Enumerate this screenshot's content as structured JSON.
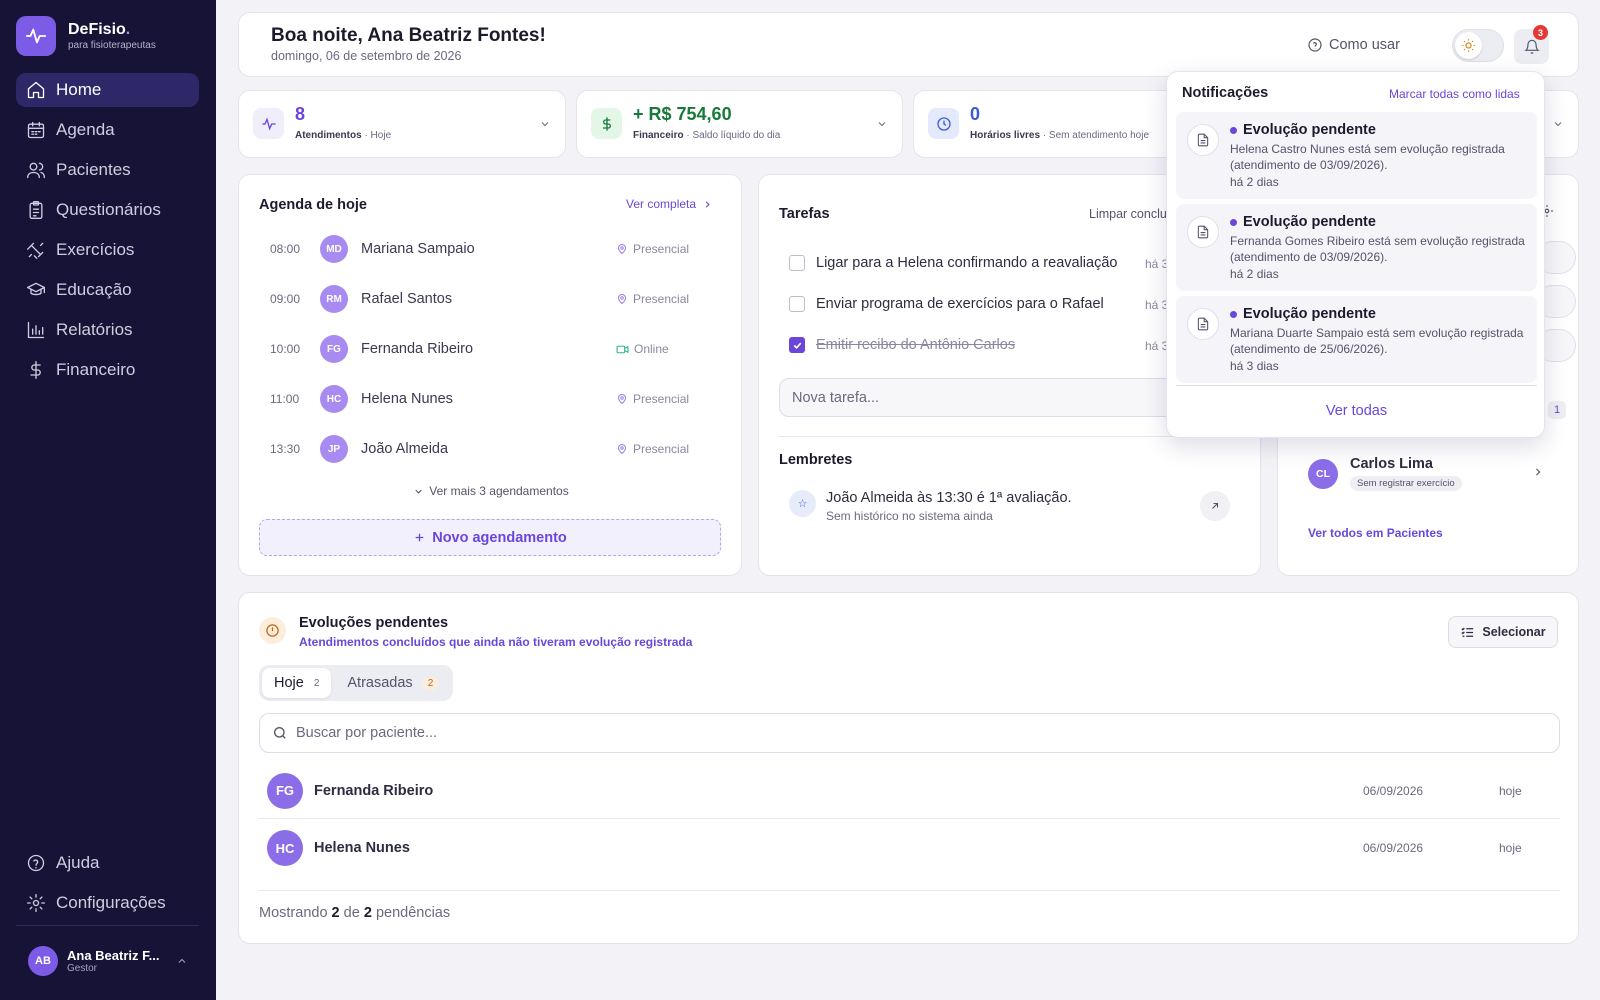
{
  "sidebar": {
    "app_name": "DeFisio",
    "app_tagline": "para fisioterapeutas",
    "nav": [
      {
        "label": "Home",
        "icon": "home-icon",
        "active": true
      },
      {
        "label": "Agenda",
        "icon": "calendar-icon"
      },
      {
        "label": "Pacientes",
        "icon": "users-icon"
      },
      {
        "label": "Questionários",
        "icon": "clipboard-icon"
      },
      {
        "label": "Exercícios",
        "icon": "dumbbell-icon"
      },
      {
        "label": "Educação",
        "icon": "graduation-cap-icon"
      },
      {
        "label": "Relatórios",
        "icon": "bar-chart-icon"
      },
      {
        "label": "Financeiro",
        "icon": "dollar-icon"
      }
    ],
    "bottom": [
      {
        "label": "Ajuda",
        "icon": "help-circle-icon"
      },
      {
        "label": "Configurações",
        "icon": "gear-icon"
      }
    ],
    "user": {
      "initials": "AB",
      "name": "Ana Beatriz F...",
      "role": "Gestor"
    }
  },
  "header": {
    "greeting": "Boa noite, Ana Beatriz Fontes!",
    "date": "domingo, 06 de setembro de 2026",
    "how_to_use": "Como usar",
    "notif_count": "3"
  },
  "stats": [
    {
      "value": "8",
      "label": "Atendimentos",
      "sub": "· Hoje",
      "color": "#6a47d8"
    },
    {
      "value": "+ R$ 754,60",
      "label": "Financeiro",
      "sub": "· Saldo líquido do dia",
      "color": "#177a3a"
    },
    {
      "value": "0",
      "label": "Horários livres",
      "sub": "· Sem atendimento hoje",
      "color": "#3b5bd6"
    }
  ],
  "agenda": {
    "title": "Agenda de hoje",
    "see_all": "Ver completa",
    "items": [
      {
        "time": "08:00",
        "initials": "MD",
        "name": "Mariana Sampaio",
        "type": "Presencial"
      },
      {
        "time": "09:00",
        "initials": "RM",
        "name": "Rafael Santos",
        "type": "Presencial"
      },
      {
        "time": "10:00",
        "initials": "FG",
        "name": "Fernanda Ribeiro",
        "type": "Online"
      },
      {
        "time": "11:00",
        "initials": "HC",
        "name": "Helena Nunes",
        "type": "Presencial"
      },
      {
        "time": "13:30",
        "initials": "JP",
        "name": "João Almeida",
        "type": "Presencial"
      }
    ],
    "more": "Ver mais 3 agendamentos",
    "new_button": "Novo agendamento"
  },
  "tasks": {
    "title": "Tarefas",
    "clear": "Limpar conclu",
    "items": [
      {
        "text": "Ligar para a Helena confirmando a reavaliação",
        "ago": "há 3",
        "done": false
      },
      {
        "text": "Enviar programa de exercícios para o Rafael",
        "ago": "há 3",
        "done": false
      },
      {
        "text": "Emitir recibo do Antônio Carlos",
        "ago": "há 3",
        "done": true
      }
    ],
    "new_placeholder": "Nova tarefa...",
    "reminders_title": "Lembretes",
    "reminder": {
      "text": "João Almeida às 13:30 é 1ª avaliação.",
      "sub": "Sem histórico no sistema ainda"
    }
  },
  "patients": {
    "badge": "1",
    "item": {
      "initials": "CL",
      "name": "Carlos Lima",
      "tag": "Sem registrar exercício"
    },
    "see_all": "Ver todos em Pacientes"
  },
  "evolutions": {
    "title": "Evoluções pendentes",
    "subtitle": "Atendimentos concluídos que ainda não tiveram evolução registrada",
    "select_button": "Selecionar",
    "tabs": [
      {
        "label": "Hoje",
        "count": "2",
        "active": true
      },
      {
        "label": "Atrasadas",
        "count": "2"
      }
    ],
    "search_placeholder": "Buscar por paciente...",
    "rows": [
      {
        "initials": "FG",
        "name": "Fernanda Ribeiro",
        "date": "06/09/2026",
        "when": "hoje"
      },
      {
        "initials": "HC",
        "name": "Helena Nunes",
        "date": "06/09/2026",
        "when": "hoje"
      }
    ],
    "footer": {
      "prefix": "Mostrando",
      "shown": "2",
      "of": "de",
      "total": "2",
      "suffix": "pendências"
    }
  },
  "notifications": {
    "title": "Notificações",
    "mark_all": "Marcar todas como lidas",
    "items": [
      {
        "title": "Evolução pendente",
        "body": "Helena Castro Nunes está sem evolução registrada (atendimento de 03/09/2026).",
        "time": "há 2 dias"
      },
      {
        "title": "Evolução pendente",
        "body": "Fernanda Gomes Ribeiro está sem evolução registrada (atendimento de 03/09/2026).",
        "time": "há 2 dias"
      },
      {
        "title": "Evolução pendente",
        "body": "Mariana Duarte Sampaio está sem evolução registrada (atendimento de 25/06/2026).",
        "time": "há 3 dias"
      }
    ],
    "see_all": "Ver todas"
  }
}
